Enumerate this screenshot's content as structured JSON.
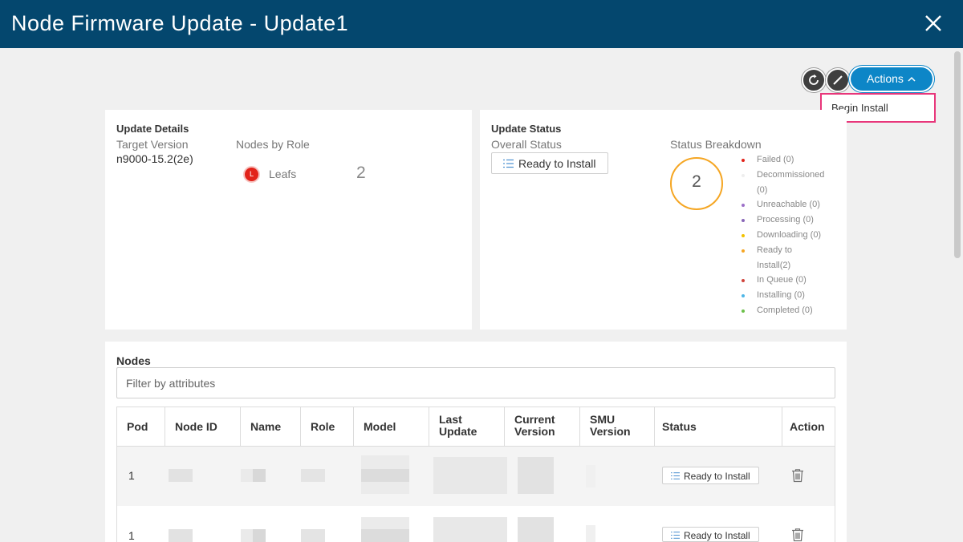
{
  "window": {
    "title": "Node Firmware Update - Update1"
  },
  "toolbar": {
    "actions_label": "Actions"
  },
  "actions_menu": {
    "items": [
      "Begin Install"
    ]
  },
  "update_details": {
    "title": "Update Details",
    "target_version_label": "Target Version",
    "target_version_value": "n9000-15.2(2e)",
    "nodes_by_role_label": "Nodes by Role",
    "role_badge": "L",
    "role_name": "Leafs",
    "role_count": "2"
  },
  "update_status": {
    "title": "Update Status",
    "overall_status_label": "Overall Status",
    "overall_status_value": "Ready to Install",
    "breakdown_label": "Status Breakdown",
    "total": "2",
    "legend": [
      {
        "lines": [
          "Failed (0)"
        ],
        "color": "#e2231a"
      },
      {
        "lines": [
          "Decommissioned",
          "(0)"
        ],
        "color": "#eeeeee"
      },
      {
        "lines": [
          "Unreachable (0)"
        ],
        "color": "#9c6fc8"
      },
      {
        "lines": [
          "Processing (0)"
        ],
        "color": "#8a68b8"
      },
      {
        "lines": [
          "Downloading (0)"
        ],
        "color": "#f2c200"
      },
      {
        "lines": [
          "Ready to",
          "Install(2)"
        ],
        "color": "#f5a623"
      },
      {
        "lines": [
          "In Queue (0)"
        ],
        "color": "#d0443c"
      },
      {
        "lines": [
          "Installing (0)"
        ],
        "color": "#4fb6e6"
      },
      {
        "lines": [
          "Completed (0)"
        ],
        "color": "#6cc04a"
      }
    ]
  },
  "nodes": {
    "title": "Nodes",
    "filter_placeholder": "Filter by attributes",
    "columns": [
      "Pod",
      "Node ID",
      "Name",
      "Role",
      "Model",
      "Last Update",
      "Current Version",
      "SMU Version",
      "Status",
      "Action"
    ],
    "rows": [
      {
        "pod": "1",
        "status": "Ready to Install"
      },
      {
        "pod": "1",
        "status": "Ready to Install"
      }
    ]
  },
  "colors": {
    "titlebar": "#04476e",
    "accent": "#0d86c7",
    "highlight": "#e8367a",
    "ready_ring": "#f5a623",
    "role_badge": "#e2231a"
  }
}
